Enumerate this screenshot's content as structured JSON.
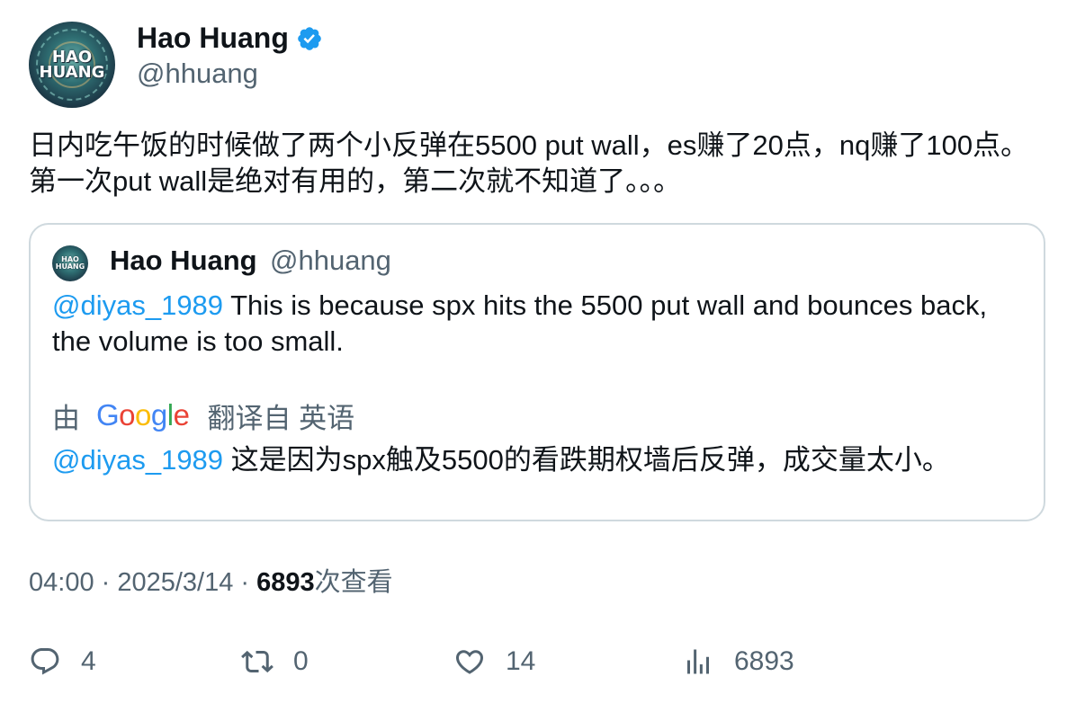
{
  "author": {
    "name": "Hao Huang",
    "handle": "@hhuang",
    "avatar_text": "HAO\nHUANG",
    "verified_color": "#1d9bf0"
  },
  "tweet": {
    "text": "日内吃午饭的时候做了两个小反弹在5500 put wall，es赚了20点，nq赚了100点。第一次put wall是绝对有用的，第二次就不知道了。。。"
  },
  "quoted_tweet": {
    "author_name": "Hao Huang",
    "author_handle": "@hhuang",
    "mention": "@diyas_1989",
    "text": " This is because spx hits the 5500 put wall and bounces back, the volume is too small.",
    "translation": {
      "prefix": "由",
      "provider_letters": [
        "G",
        "o",
        "o",
        "g",
        "l",
        "e"
      ],
      "suffix": "翻译自 英语",
      "mention": "@diyas_1989",
      "text": " 这是因为spx触及5500的看跌期权墙后反弹，成交量太小。"
    }
  },
  "meta": {
    "time": "04:00",
    "separator": " · ",
    "date": "2025/3/14",
    "views_count": "6893",
    "views_label": "次查看"
  },
  "actions": {
    "reply": {
      "icon": "reply-icon",
      "count": "4"
    },
    "retweet": {
      "icon": "retweet-icon",
      "count": "0"
    },
    "like": {
      "icon": "heart-icon",
      "count": "14"
    },
    "views": {
      "icon": "analytics-icon",
      "count": "6893"
    }
  },
  "colors": {
    "accent": "#1d9bf0",
    "secondary_text": "#536471",
    "border": "#cfd9de"
  }
}
